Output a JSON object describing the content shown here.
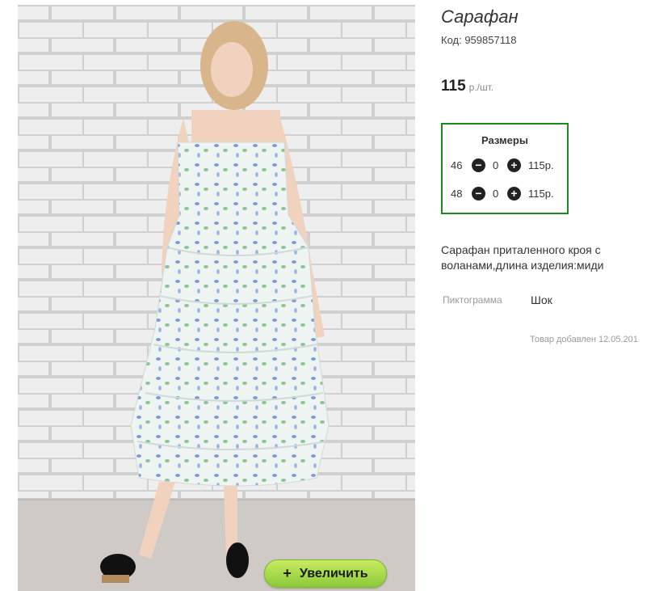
{
  "product": {
    "title": "Сарафан",
    "code": "Код: 959857118",
    "price": "115",
    "price_unit": "р./шт.",
    "zoom_label": "Увеличить",
    "zoom_plus": "+",
    "sizes_title": "Размеры",
    "sizes": [
      {
        "size": "46",
        "qty": "0",
        "price": "115р."
      },
      {
        "size": "48",
        "qty": "0",
        "price": "115р."
      }
    ],
    "description": "Сарафан приталенного кроя с воланами,длина изделия:миди",
    "pictogram_label": "Пиктограмма",
    "pictogram_value": "Шок",
    "added": "Товар добавлен 12.05.201"
  },
  "colors": {
    "sizes_border": "#1e8a1e",
    "zoom_button": "#a6d84a"
  }
}
